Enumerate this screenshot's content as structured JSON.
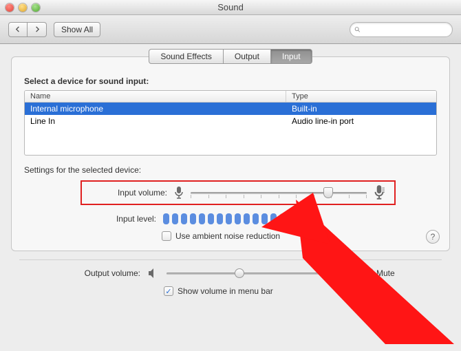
{
  "window": {
    "title": "Sound"
  },
  "toolbar": {
    "show_all": "Show All",
    "search_placeholder": ""
  },
  "tabs": [
    {
      "label": "Sound Effects",
      "active": false
    },
    {
      "label": "Output",
      "active": false
    },
    {
      "label": "Input",
      "active": true
    }
  ],
  "device_section": {
    "heading": "Select a device for sound input:",
    "columns": {
      "name": "Name",
      "type": "Type"
    },
    "rows": [
      {
        "name": "Internal microphone",
        "type": "Built-in",
        "selected": true
      },
      {
        "name": "Line In",
        "type": "Audio line-in port",
        "selected": false
      }
    ]
  },
  "settings": {
    "heading": "Settings for the selected device:",
    "input_volume_label": "Input volume:",
    "input_volume_percent": 78,
    "input_level_label": "Input level:",
    "input_level_segments": 15,
    "input_level_active": 13,
    "noise_reduction_label": "Use ambient noise reduction",
    "noise_reduction_checked": false
  },
  "output": {
    "label": "Output volume:",
    "percent": 46,
    "mute_label": "Mute",
    "mute_checked": false,
    "show_in_menu_label": "Show volume in menu bar",
    "show_in_menu_checked": true
  },
  "help_tooltip": "?"
}
